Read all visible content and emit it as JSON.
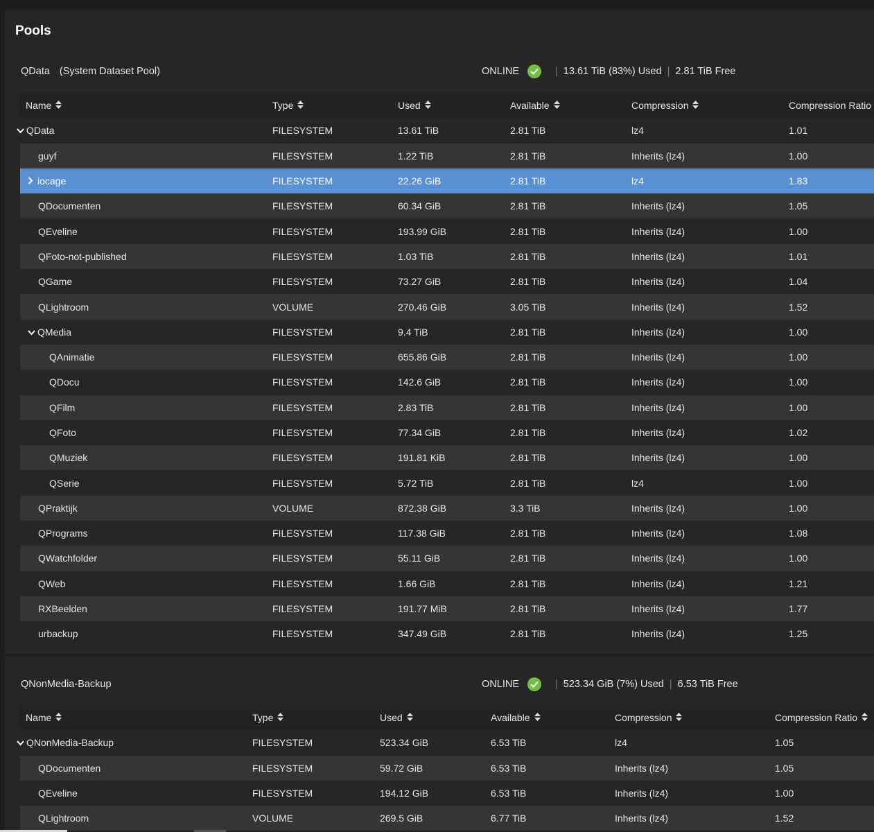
{
  "page_title": "Pools",
  "colors": {
    "selected_row": "#5890d3",
    "online_icon": "#71bf44"
  },
  "pools": [
    {
      "name": "QData",
      "note": "(System Dataset Pool)",
      "status": "ONLINE",
      "used": "13.61 TiB (83%) Used",
      "free": "2.81 TiB Free",
      "columns": [
        "Name",
        "Type",
        "Used",
        "Available",
        "Compression",
        "Compression Ratio"
      ],
      "rows": [
        {
          "name": "QData",
          "level": 0,
          "expander": "expanded",
          "type": "FILESYSTEM",
          "used": "13.61 TiB",
          "available": "2.81 TiB",
          "compression": "lz4",
          "ratio": "1.01"
        },
        {
          "name": "guyf",
          "level": 1,
          "type": "FILESYSTEM",
          "used": "1.22 TiB",
          "available": "2.81 TiB",
          "compression": "Inherits (lz4)",
          "ratio": "1.00"
        },
        {
          "name": "iocage",
          "level": 1,
          "expander": "collapsed",
          "selected": true,
          "type": "FILESYSTEM",
          "used": "22.26 GiB",
          "available": "2.81 TiB",
          "compression": "lz4",
          "ratio": "1.83"
        },
        {
          "name": "QDocumenten",
          "level": 1,
          "type": "FILESYSTEM",
          "used": "60.34 GiB",
          "available": "2.81 TiB",
          "compression": "Inherits (lz4)",
          "ratio": "1.05"
        },
        {
          "name": "QEveline",
          "level": 1,
          "type": "FILESYSTEM",
          "used": "193.99 GiB",
          "available": "2.81 TiB",
          "compression": "Inherits (lz4)",
          "ratio": "1.00"
        },
        {
          "name": "QFoto-not-published",
          "level": 1,
          "type": "FILESYSTEM",
          "used": "1.03 TiB",
          "available": "2.81 TiB",
          "compression": "Inherits (lz4)",
          "ratio": "1.01"
        },
        {
          "name": "QGame",
          "level": 1,
          "type": "FILESYSTEM",
          "used": "73.27 GiB",
          "available": "2.81 TiB",
          "compression": "Inherits (lz4)",
          "ratio": "1.04"
        },
        {
          "name": "QLightroom",
          "level": 1,
          "type": "VOLUME",
          "used": "270.46 GiB",
          "available": "3.05 TiB",
          "compression": "Inherits (lz4)",
          "ratio": "1.52"
        },
        {
          "name": "QMedia",
          "level": 1,
          "expander": "expanded",
          "type": "FILESYSTEM",
          "used": "9.4 TiB",
          "available": "2.81 TiB",
          "compression": "Inherits (lz4)",
          "ratio": "1.00"
        },
        {
          "name": "QAnimatie",
          "level": 2,
          "type": "FILESYSTEM",
          "used": "655.86 GiB",
          "available": "2.81 TiB",
          "compression": "Inherits (lz4)",
          "ratio": "1.00"
        },
        {
          "name": "QDocu",
          "level": 2,
          "type": "FILESYSTEM",
          "used": "142.6 GiB",
          "available": "2.81 TiB",
          "compression": "Inherits (lz4)",
          "ratio": "1.00"
        },
        {
          "name": "QFilm",
          "level": 2,
          "type": "FILESYSTEM",
          "used": "2.83 TiB",
          "available": "2.81 TiB",
          "compression": "Inherits (lz4)",
          "ratio": "1.00"
        },
        {
          "name": "QFoto",
          "level": 2,
          "type": "FILESYSTEM",
          "used": "77.34 GiB",
          "available": "2.81 TiB",
          "compression": "Inherits (lz4)",
          "ratio": "1.02"
        },
        {
          "name": "QMuziek",
          "level": 2,
          "type": "FILESYSTEM",
          "used": "191.81 KiB",
          "available": "2.81 TiB",
          "compression": "Inherits (lz4)",
          "ratio": "1.00"
        },
        {
          "name": "QSerie",
          "level": 2,
          "type": "FILESYSTEM",
          "used": "5.72 TiB",
          "available": "2.81 TiB",
          "compression": "lz4",
          "ratio": "1.00"
        },
        {
          "name": "QPraktijk",
          "level": 1,
          "type": "VOLUME",
          "used": "872.38 GiB",
          "available": "3.3 TiB",
          "compression": "Inherits (lz4)",
          "ratio": "1.00"
        },
        {
          "name": "QPrograms",
          "level": 1,
          "type": "FILESYSTEM",
          "used": "117.38 GiB",
          "available": "2.81 TiB",
          "compression": "Inherits (lz4)",
          "ratio": "1.08"
        },
        {
          "name": "QWatchfolder",
          "level": 1,
          "type": "FILESYSTEM",
          "used": "55.11 GiB",
          "available": "2.81 TiB",
          "compression": "Inherits (lz4)",
          "ratio": "1.00"
        },
        {
          "name": "QWeb",
          "level": 1,
          "type": "FILESYSTEM",
          "used": "1.66 GiB",
          "available": "2.81 TiB",
          "compression": "Inherits (lz4)",
          "ratio": "1.21"
        },
        {
          "name": "RXBeelden",
          "level": 1,
          "type": "FILESYSTEM",
          "used": "191.77 MiB",
          "available": "2.81 TiB",
          "compression": "Inherits (lz4)",
          "ratio": "1.77"
        },
        {
          "name": "urbackup",
          "level": 1,
          "type": "FILESYSTEM",
          "used": "347.49 GiB",
          "available": "2.81 TiB",
          "compression": "Inherits (lz4)",
          "ratio": "1.25"
        }
      ]
    },
    {
      "name": "QNonMedia-Backup",
      "note": "",
      "status": "ONLINE",
      "used": "523.34 GiB (7%) Used",
      "free": "6.53 TiB Free",
      "columns": [
        "Name",
        "Type",
        "Used",
        "Available",
        "Compression",
        "Compression Ratio"
      ],
      "rows": [
        {
          "name": "QNonMedia-Backup",
          "level": 0,
          "expander": "expanded",
          "type": "FILESYSTEM",
          "used": "523.34 GiB",
          "available": "6.53 TiB",
          "compression": "lz4",
          "ratio": "1.05"
        },
        {
          "name": "QDocumenten",
          "level": 1,
          "type": "FILESYSTEM",
          "used": "59.72 GiB",
          "available": "6.53 TiB",
          "compression": "Inherits (lz4)",
          "ratio": "1.05"
        },
        {
          "name": "QEveline",
          "level": 1,
          "type": "FILESYSTEM",
          "used": "194.12 GiB",
          "available": "6.53 TiB",
          "compression": "Inherits (lz4)",
          "ratio": "1.00"
        },
        {
          "name": "QLightroom",
          "level": 1,
          "type": "VOLUME",
          "used": "269.5 GiB",
          "available": "6.77 TiB",
          "compression": "Inherits (lz4)",
          "ratio": "1.52"
        }
      ]
    }
  ]
}
